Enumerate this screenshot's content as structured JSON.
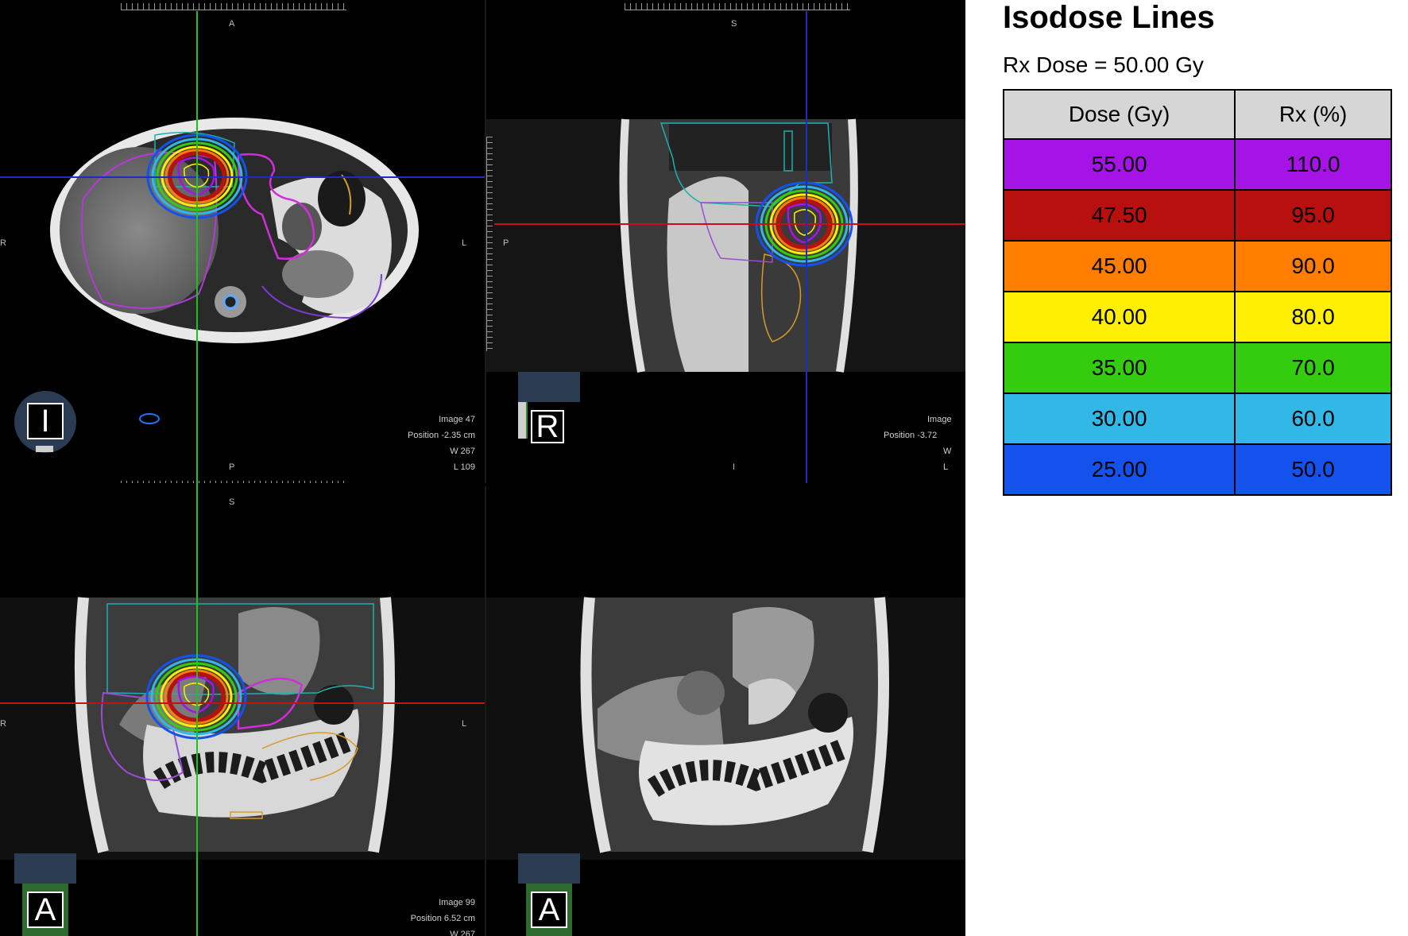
{
  "viewer": {
    "axial": {
      "orient_top": "A",
      "orient_bottom": "P",
      "orient_left": "R",
      "orient_right": "L",
      "cube_label": "I",
      "info": {
        "image": "Image  47",
        "position": "Position  -2.35 cm",
        "ww": "W  267",
        "wl": "L  109"
      }
    },
    "sagittal": {
      "orient_top": "S",
      "orient_bottom": "I",
      "orient_left": "P",
      "cube_label": "R",
      "info": {
        "image": "Image",
        "position": "Position  -3.72",
        "ww": "W",
        "wl": "L"
      }
    },
    "coronal": {
      "orient_top": "S",
      "orient_left": "R",
      "orient_right": "L",
      "cube_label": "A",
      "info": {
        "image": "Image  99",
        "position": "Position  6.52 cm",
        "ww": "W  267"
      }
    },
    "coronal_plain": {
      "cube_label": "A"
    }
  },
  "legend": {
    "title": "Isodose Lines",
    "rx_dose": "Rx Dose = 50.00 Gy",
    "headers": [
      "Dose (Gy)",
      "Rx (%)"
    ],
    "rows": [
      {
        "dose": "55.00",
        "rx": "110.0",
        "color": "#a613e6"
      },
      {
        "dose": "47.50",
        "rx": "95.0",
        "color": "#b80f0f"
      },
      {
        "dose": "45.00",
        "rx": "90.0",
        "color": "#ff7e00"
      },
      {
        "dose": "40.00",
        "rx": "80.0",
        "color": "#ffef00"
      },
      {
        "dose": "35.00",
        "rx": "70.0",
        "color": "#33cc0e"
      },
      {
        "dose": "30.00",
        "rx": "60.0",
        "color": "#32b8e6"
      },
      {
        "dose": "25.00",
        "rx": "50.0",
        "color": "#1452ee"
      }
    ]
  }
}
